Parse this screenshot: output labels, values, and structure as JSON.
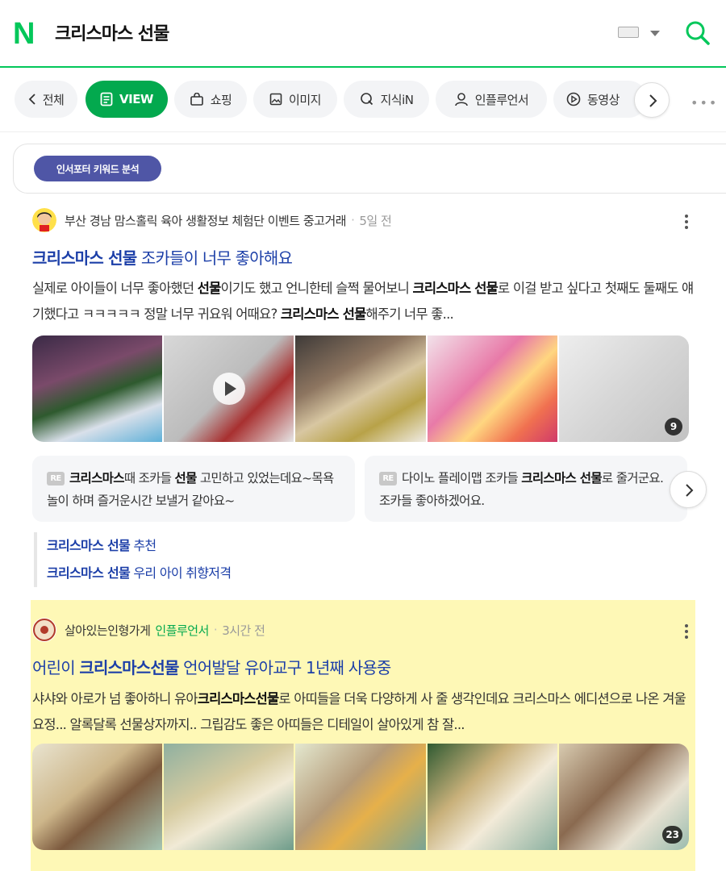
{
  "header": {
    "logo": "N",
    "query": "크리스마스 선물"
  },
  "tabs": [
    {
      "label": "전체",
      "icon": "chevron-left-icon"
    },
    {
      "label": "VIEW",
      "icon": "document-icon",
      "active": true
    },
    {
      "label": "쇼핑",
      "icon": "bag-icon"
    },
    {
      "label": "이미지",
      "icon": "image-icon"
    },
    {
      "label": "지식iN",
      "icon": "q-icon"
    },
    {
      "label": "인플루언서",
      "icon": "person-icon"
    },
    {
      "label": "동영상",
      "icon": "play-circle-icon"
    }
  ],
  "keyword_badge": "인서포터 키워드 분석",
  "post1": {
    "author": "부산 경남 맘스홀릭 육아 생활정보 체험단 이벤트 중고거래",
    "time": "5일 전",
    "title_bold": "크리스마스 선물",
    "title_rest": " 조카들이 너무 좋아해요",
    "desc": [
      {
        "t": "실제로 아이들이 너무 좋아했던 ",
        "b": false
      },
      {
        "t": "선물",
        "b": true
      },
      {
        "t": "이기도 했고 언니한테 슬쩍 물어보니 ",
        "b": false
      },
      {
        "t": "크리스마스 선물",
        "b": true
      },
      {
        "t": "로 이걸 받고 싶다고 첫째도 둘째도 얘기했다고 ㅋㅋㅋㅋㅋ 정말 너무 귀요워 어때요? ",
        "b": false
      },
      {
        "t": "크리스마스 선물",
        "b": true
      },
      {
        "t": "해주기 너무 좋...",
        "b": false
      }
    ],
    "image_count": "9",
    "replies": [
      {
        "badge": "RE",
        "parts": [
          {
            "t": "크리스마스",
            "b": true
          },
          {
            "t": "때 조카들 ",
            "b": false
          },
          {
            "t": "선물",
            "b": true
          },
          {
            "t": " 고민하고 있었는데요~목욕놀이 하며 즐거운시간 보낼거 같아요~",
            "b": false
          }
        ]
      },
      {
        "badge": "RE",
        "parts": [
          {
            "t": "다이노 플레이맵 조카들 ",
            "b": false
          },
          {
            "t": "크리스마스 선물",
            "b": true
          },
          {
            "t": "로 줄거군요. 조카들 좋아하겠어요.",
            "b": false
          }
        ]
      }
    ],
    "related": [
      {
        "bold": "크리스마스 선물",
        "rest": " 추천"
      },
      {
        "bold": "크리스마스 선물",
        "rest": " 우리 아이 취향저격"
      }
    ]
  },
  "post2": {
    "author": "살아있는인형가게",
    "badge": "인플루언서",
    "time": "3시간 전",
    "title_pre": "어린이 ",
    "title_bold": "크리스마스선물",
    "title_rest": " 언어발달 유아교구 1년째 사용중",
    "desc": [
      {
        "t": "샤샤와 아로가 넘 좋아하니 유아",
        "b": false
      },
      {
        "t": "크리스마스선물",
        "b": true
      },
      {
        "t": "로 아띠들을 더욱 다양하게 사 줄 생각인데요 크리스마스 에디션으로 나온 겨울요정... 알록달록 선물상자까지.. 그립감도 좋은 아띠들은 디테일이 살아있게 참 잘...",
        "b": false
      }
    ],
    "image_count": "23",
    "highlight_color": "#fef8b6"
  },
  "colors": {
    "brand": "#03c75a",
    "active_tab": "#03a94e",
    "title_link": "#1c3fa8",
    "keyword_badge": "#4f56a6"
  }
}
